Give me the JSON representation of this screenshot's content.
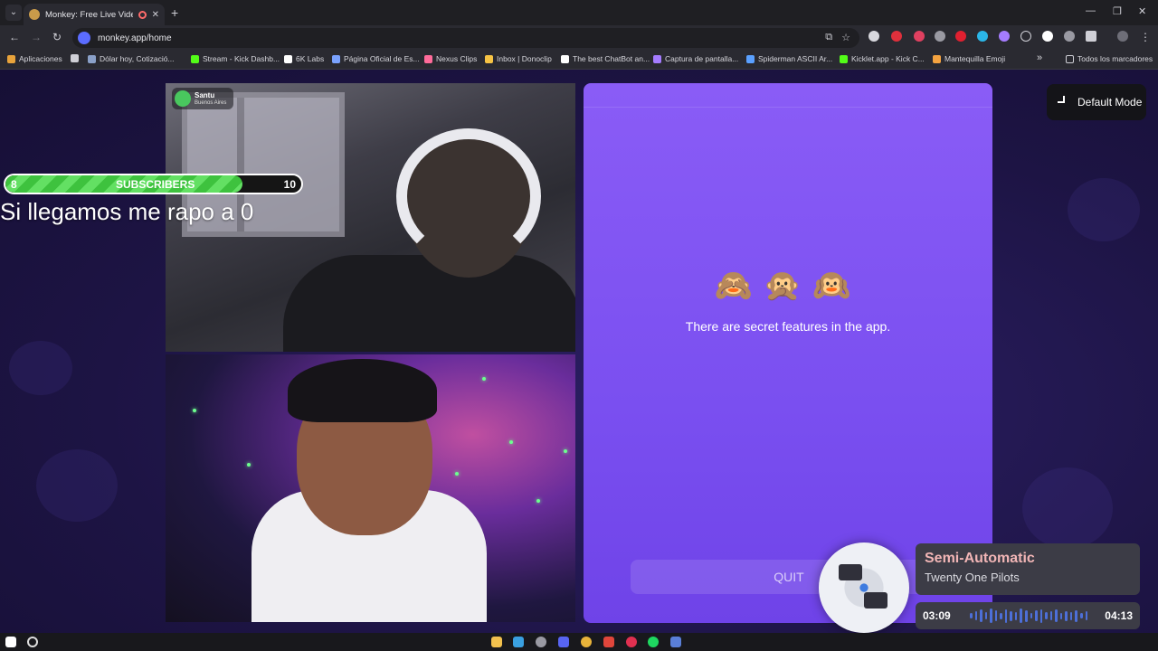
{
  "browser": {
    "tab_title": "Monkey: Free Live Video Ch",
    "tab_close": "✕",
    "new_tab": "+",
    "url": "monkey.app/home",
    "window_controls": [
      "—",
      "❐",
      "✕"
    ],
    "bookmarks": [
      {
        "label": "Aplicaciones",
        "color": "#e8a33b"
      },
      {
        "label": "Dólar hoy, Cotizació...",
        "color": "#8aa0c8"
      },
      {
        "label": "Stream - Kick Dashb...",
        "color": "#53fc18"
      },
      {
        "label": "6K Labs",
        "color": "#ffffff"
      },
      {
        "label": "Página Oficial de Es...",
        "color": "#7aa2ff"
      },
      {
        "label": "Nexus Clips",
        "color": "#ff6b9a"
      },
      {
        "label": "Inbox | Donoclip",
        "color": "#f6c344"
      },
      {
        "label": "The best ChatBot an...",
        "color": "#ffffff"
      },
      {
        "label": "Captura de pantalla...",
        "color": "#a57cff"
      },
      {
        "label": "Spiderman ASCII Ar...",
        "color": "#5aa0ff"
      },
      {
        "label": "Kicklet.app - Kick C...",
        "color": "#53fc18"
      },
      {
        "label": "Mantequilla Emoji",
        "color": "#f4a340"
      }
    ],
    "bookmarks_more": "»",
    "all_bookmarks": "Todos los marcadores"
  },
  "overlay": {
    "sub_current": "8",
    "sub_label": "SUBSCRIBERS",
    "sub_goal": "10",
    "sub_progress": 0.8,
    "goal_text": "Si llegamos me rapo a 0"
  },
  "peer": {
    "name": "Santu",
    "location": "Buenos Aires"
  },
  "panel": {
    "emojis": "🙈🙊🙉",
    "message": "There are secret features in the app.",
    "quit_label": "QUIT"
  },
  "mode_button": {
    "label": "Default Mode"
  },
  "music": {
    "title": "Semi-Automatic",
    "artist": "Twenty One Pilots",
    "current_time": "03:09",
    "total_time": "04:13",
    "progress": 0.75,
    "accent": "#4f7ce6"
  }
}
